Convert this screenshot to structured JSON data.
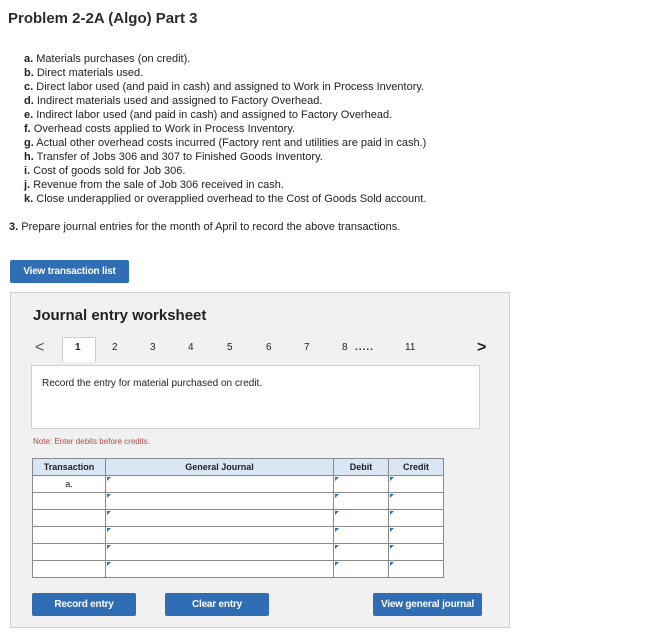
{
  "page_title": "Problem 2-2A (Algo) Part 3",
  "items": [
    {
      "letter": "a.",
      "text": "Materials purchases (on credit)."
    },
    {
      "letter": "b.",
      "text": "Direct materials used."
    },
    {
      "letter": "c.",
      "text": "Direct labor used (and paid in cash) and assigned to Work in Process Inventory."
    },
    {
      "letter": "d.",
      "text": "Indirect materials used and assigned to Factory Overhead."
    },
    {
      "letter": "e.",
      "text": "Indirect labor used (and paid in cash) and assigned to Factory Overhead."
    },
    {
      "letter": "f.",
      "text": "Overhead costs applied to Work in Process Inventory."
    },
    {
      "letter": "g.",
      "text": "Actual other overhead costs incurred (Factory rent and utilities are paid in cash.)"
    },
    {
      "letter": "h.",
      "text": "Transfer of Jobs 306 and 307 to Finished Goods Inventory."
    },
    {
      "letter": "i.",
      "text": "Cost of goods sold for Job 306."
    },
    {
      "letter": "j.",
      "text": "Revenue from the sale of Job 306 received in cash."
    },
    {
      "letter": "k.",
      "text": "Close underapplied or overapplied overhead to the Cost of Goods Sold account."
    }
  ],
  "question": {
    "number": "3.",
    "text": "Prepare journal entries for the month of April to record the above transactions."
  },
  "view_transaction_list": "View transaction list",
  "worksheet": {
    "title": "Journal entry worksheet",
    "prev_icon": "<",
    "next_icon": ">",
    "pages": [
      "1",
      "2",
      "3",
      "4",
      "5",
      "6",
      "7",
      "8"
    ],
    "ellipsis": ".....",
    "last_page": "11",
    "active_page": "1",
    "instruction": "Record the entry for material purchased on credit.",
    "note": "Note: Enter debits before credits.",
    "headers": {
      "transaction": "Transaction",
      "general_journal": "General Journal",
      "debit": "Debit",
      "credit": "Credit"
    },
    "first_transaction": "a."
  },
  "buttons": {
    "record": "Record entry",
    "clear": "Clear entry",
    "view_general": "View general journal"
  },
  "colors": {
    "accent": "#2f6db5",
    "header_bg": "#dbe6f4",
    "note": "#b04a4a"
  }
}
